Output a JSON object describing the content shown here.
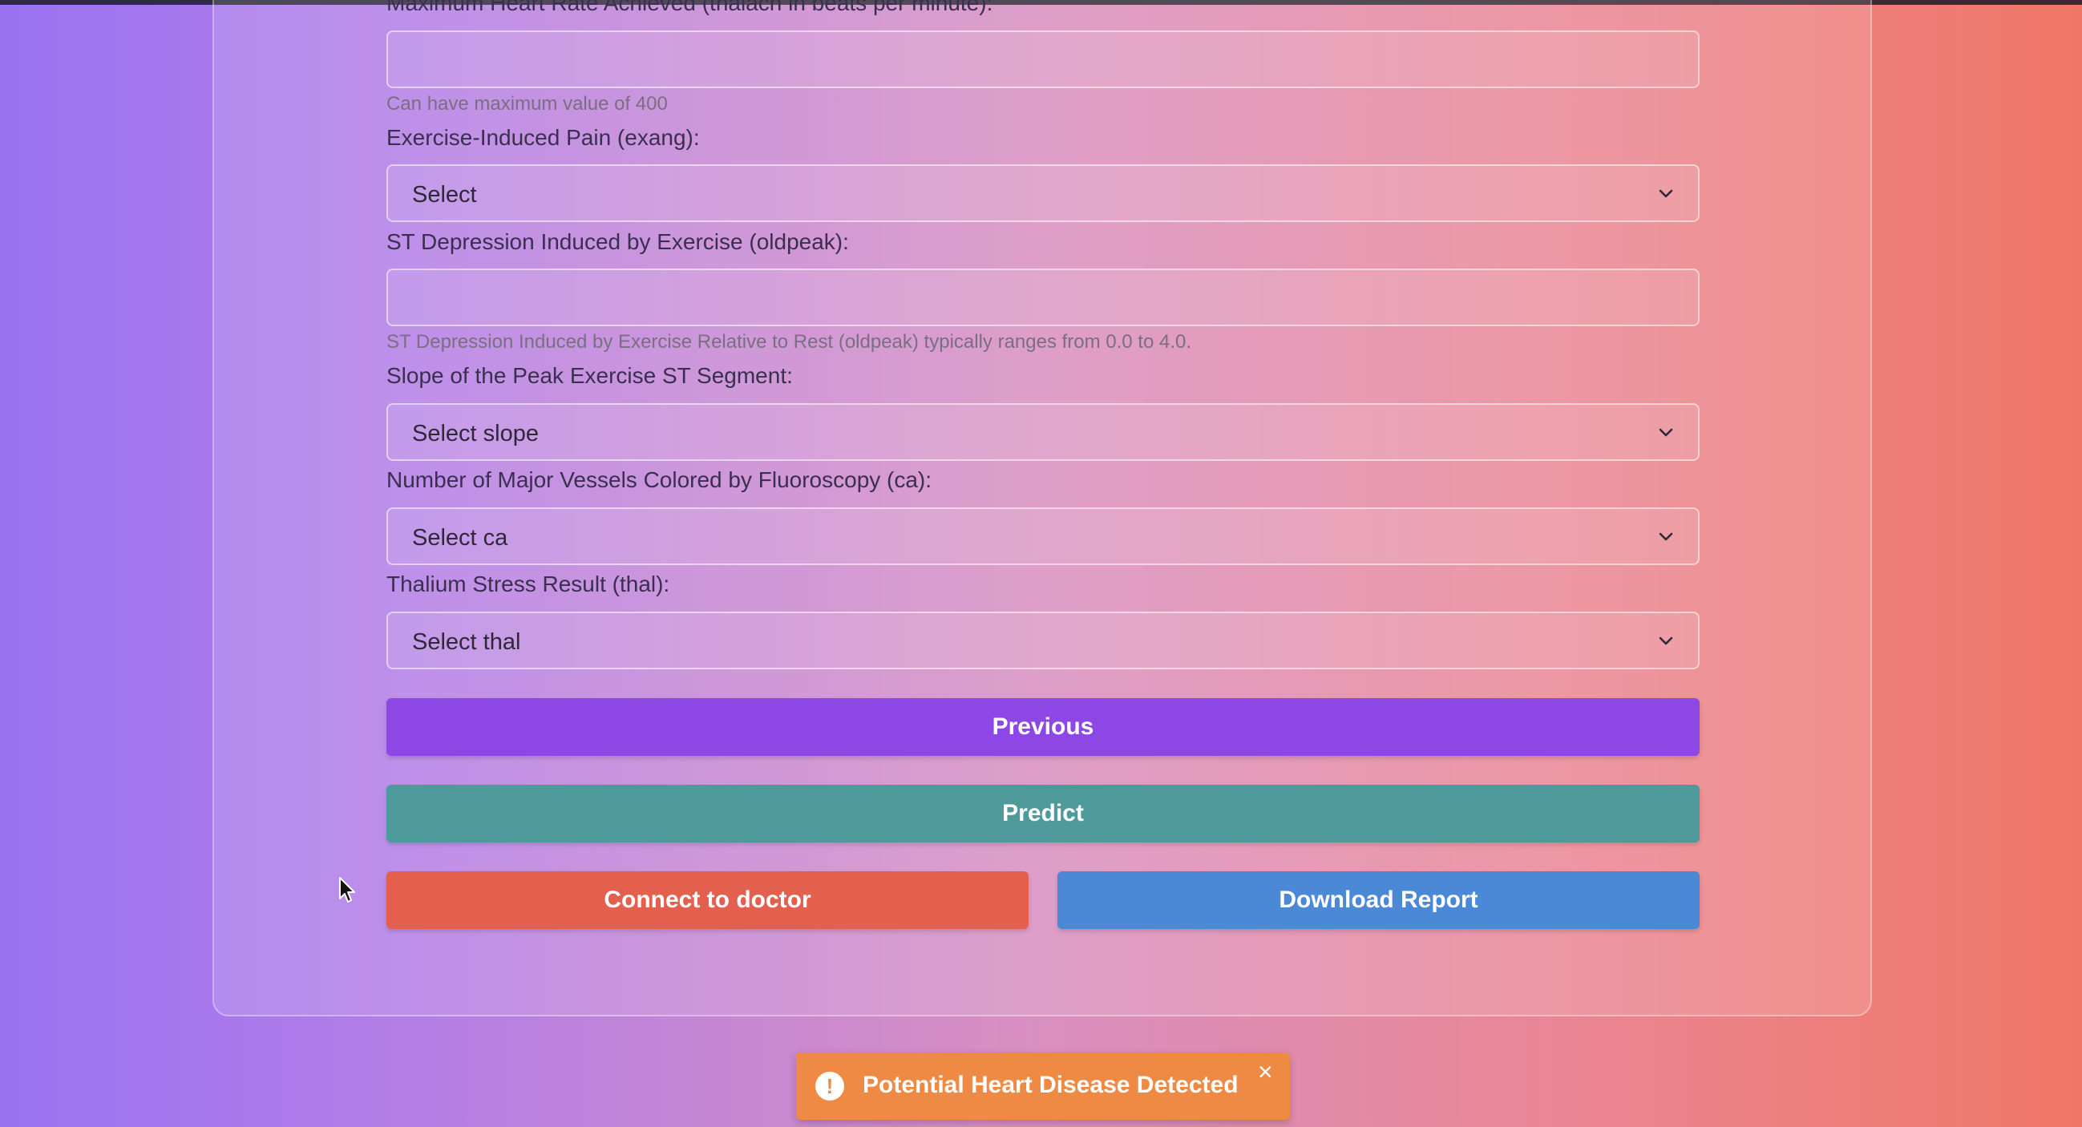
{
  "form": {
    "thalach_label": "Maximum Heart Rate Achieved (thalach in beats per minute):",
    "thalach_value": "",
    "thalach_hint": "Can have maximum value of 400",
    "exang_label": "Exercise-Induced Pain (exang):",
    "exang_selected": "Select",
    "oldpeak_label": "ST Depression Induced by Exercise (oldpeak):",
    "oldpeak_value": "",
    "oldpeak_hint": "ST Depression Induced by Exercise Relative to Rest (oldpeak) typically ranges from 0.0 to 4.0.",
    "slope_label": "Slope of the Peak Exercise ST Segment:",
    "slope_selected": "Select slope",
    "ca_label": "Number of Major Vessels Colored by Fluoroscopy (ca):",
    "ca_selected": "Select ca",
    "thal_label": "Thalium Stress Result (thal):",
    "thal_selected": "Select thal"
  },
  "buttons": {
    "previous": "Previous",
    "predict": "Predict",
    "connect_doctor": "Connect to doctor",
    "download_report": "Download Report"
  },
  "toast": {
    "icon": "!",
    "message": "Potential Heart Disease Detected",
    "close": "×"
  },
  "colors": {
    "previous": "#8c47e4",
    "predict": "#4e9a9b",
    "connect_doctor": "#e3604e",
    "download_report": "#4b88d6",
    "toast": "#ee8a43"
  }
}
